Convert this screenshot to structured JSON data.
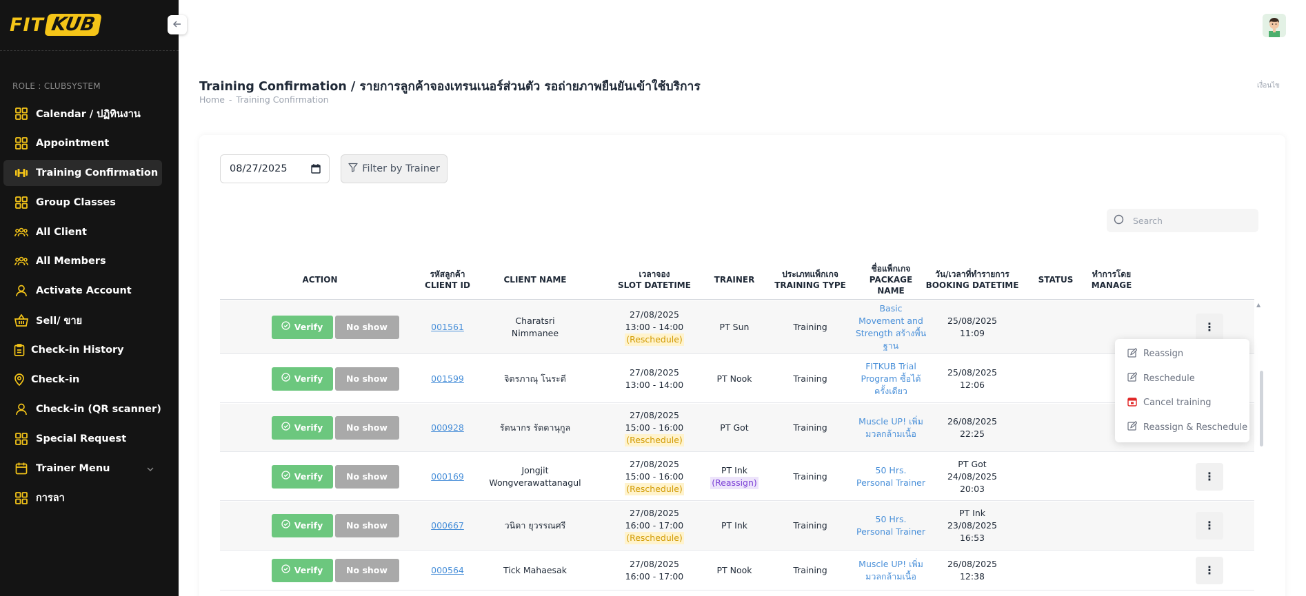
{
  "brand": {
    "fit": "FIT",
    "kub": "KUB",
    "accent": "#f5c518"
  },
  "sidebar": {
    "role": "ROLE : CLUBSYSTEM",
    "items": [
      {
        "label": "Calendar / ปฏิทินงาน",
        "icon": "grid-icon",
        "active": false
      },
      {
        "label": "Appointment",
        "icon": "grid-icon",
        "active": false
      },
      {
        "label": "Training Confirmation",
        "icon": "dumbbell-icon",
        "active": true
      },
      {
        "label": "Group Classes",
        "icon": "grid-icon",
        "active": false
      },
      {
        "label": "All Client",
        "icon": "users-icon",
        "active": false
      },
      {
        "label": "All Members",
        "icon": "users-icon",
        "active": false
      },
      {
        "label": "Activate Account",
        "icon": "user-icon",
        "active": false
      },
      {
        "label": "Sell/ ขาย",
        "icon": "basket-icon",
        "active": false
      },
      {
        "label": "Check-in History",
        "icon": "clipboard-icon",
        "active": false
      },
      {
        "label": "Check-in",
        "icon": "location-pin-icon",
        "active": false
      },
      {
        "label": "Check-in (QR scanner)",
        "icon": "user-icon",
        "active": false
      },
      {
        "label": "Special Request",
        "icon": "grid-icon",
        "active": false
      },
      {
        "label": "Trainer Menu",
        "icon": "calendar-icon",
        "active": false
      },
      {
        "label": "การลา",
        "icon": "grid-icon",
        "active": false
      }
    ]
  },
  "header": {
    "collapse_icon": "arrow-left-icon",
    "title": "Training Confirmation / รายการลูกค้าจองเทรนเนอร์ส่วนตัว รอถ่ายภาพยืนยันเข้าใช้บริการ",
    "breadcrumb": {
      "home": "Home",
      "sep": "-",
      "current": "Training Confirmation"
    },
    "logout": "เงื่อนไข"
  },
  "filters": {
    "date_value": "08/27/2025",
    "filter_label": "Filter by Trainer",
    "search_placeholder": "Search"
  },
  "table": {
    "headers": {
      "action": "ACTION",
      "client_id_th": "รหัสลูกค้า",
      "client_id": "CLIENT ID",
      "client_name": "CLIENT NAME",
      "slot_th": "เวลาจอง",
      "slot": "SLOT DATETIME",
      "trainer": "TRAINER",
      "type_th": "ประเภทแพ็กเกจ",
      "type": "TRAINING TYPE",
      "package_th": "ชื่อแพ็กเกจ",
      "package": "PACKAGE",
      "package2": "NAME",
      "booking_th": "วัน/เวลาที่ทำรายการ",
      "booking": "BOOKING DATETIME",
      "status": "STATUS",
      "manage_th": "ทำการโดย",
      "manage": "MANAGE"
    },
    "verify_label": "Verify",
    "noshow_label": "No show",
    "more_label": "⋮",
    "rows": [
      {
        "id": "001561",
        "name1": "Charatsri Nimmanee",
        "name2": "",
        "slot_date": "27/08/2025",
        "slot_time": "13:00 - 14:00",
        "slot_tag": "(Reschedule)",
        "trainer": "PT Sun",
        "trainer_tag": "",
        "type": "Training",
        "pkg1": "Basic",
        "pkg2": "Movement and",
        "pkg3": "Strength สร้างพื้น",
        "pkg4": "ฐาน",
        "bk_by": "",
        "bk_date": "25/08/2025",
        "bk_time": "11:09"
      },
      {
        "id": "001599",
        "name1": "จิตรภาณุ โนระดี",
        "name2": "",
        "slot_date": "27/08/2025",
        "slot_time": "13:00 - 14:00",
        "slot_tag": "",
        "trainer": "PT Nook",
        "trainer_tag": "",
        "type": "Training",
        "pkg1": "FITKUB Trial",
        "pkg2": "Program ซื้อได้",
        "pkg3": "ครั้งเดียว",
        "pkg4": "",
        "bk_by": "",
        "bk_date": "25/08/2025",
        "bk_time": "12:06"
      },
      {
        "id": "000928",
        "name1": "รัตนากร รัตตานุกูล",
        "name2": "",
        "slot_date": "27/08/2025",
        "slot_time": "15:00 - 16:00",
        "slot_tag": "(Reschedule)",
        "trainer": "PT Got",
        "trainer_tag": "",
        "type": "Training",
        "pkg1": "Muscle UP! เพิ่ม",
        "pkg2": "มวลกล้ามเนื้อ",
        "pkg3": "",
        "pkg4": "",
        "bk_by": "",
        "bk_date": "26/08/2025",
        "bk_time": "22:25"
      },
      {
        "id": "000169",
        "name1": "Jongjit",
        "name2": "Wongverawattanagul",
        "slot_date": "27/08/2025",
        "slot_time": "15:00 - 16:00",
        "slot_tag": "(Reschedule)",
        "trainer": "PT Ink",
        "trainer_tag": "(Reassign)",
        "type": "Training",
        "pkg1": "50 Hrs.",
        "pkg2": "Personal Trainer",
        "pkg3": "",
        "pkg4": "",
        "bk_by": "PT Got",
        "bk_date": "24/08/2025",
        "bk_time": "20:03"
      },
      {
        "id": "000667",
        "name1": "วนิดา ยุวรรณศรี",
        "name2": "",
        "slot_date": "27/08/2025",
        "slot_time": "16:00 - 17:00",
        "slot_tag": "(Reschedule)",
        "trainer": "PT Ink",
        "trainer_tag": "",
        "type": "Training",
        "pkg1": "50 Hrs.",
        "pkg2": "Personal Trainer",
        "pkg3": "",
        "pkg4": "",
        "bk_by": "PT Ink",
        "bk_date": "23/08/2025",
        "bk_time": "16:53"
      },
      {
        "id": "000564",
        "name1": "Tick Mahaesak",
        "name2": "",
        "slot_date": "27/08/2025",
        "slot_time": "16:00 - 17:00",
        "slot_tag": "",
        "trainer": "PT Nook",
        "trainer_tag": "",
        "type": "Training",
        "pkg1": "Muscle UP! เพิ่ม",
        "pkg2": "มวลกล้ามเนื้อ",
        "pkg3": "",
        "pkg4": "",
        "bk_by": "",
        "bk_date": "26/08/2025",
        "bk_time": "12:38"
      }
    ]
  },
  "dropdown": {
    "items": [
      {
        "label": "Reassign",
        "icon": "edit-icon"
      },
      {
        "label": "Reschedule",
        "icon": "edit-icon"
      },
      {
        "label": "Cancel training",
        "icon": "calendar-cancel-icon"
      },
      {
        "label": "Reassign & Reschedule",
        "icon": "edit-icon"
      }
    ]
  }
}
